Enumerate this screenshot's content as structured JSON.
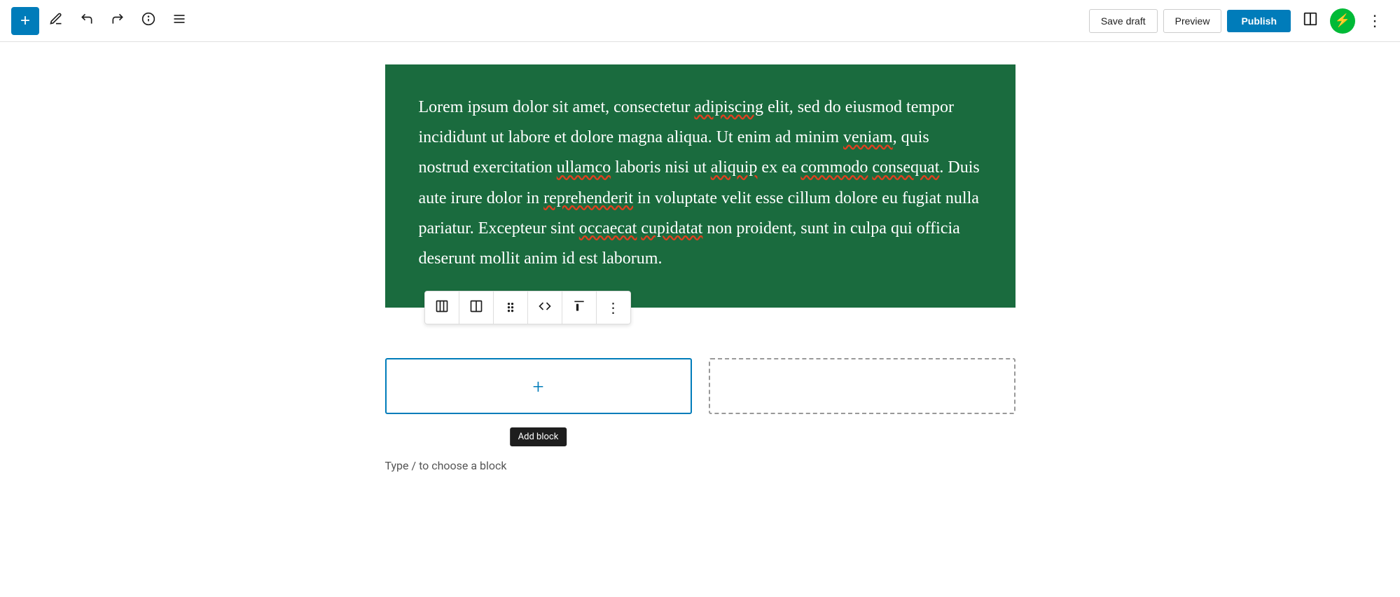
{
  "toolbar": {
    "add_button_label": "+",
    "save_draft_label": "Save draft",
    "preview_label": "Preview",
    "publish_label": "Publish",
    "tools_icon": "✏",
    "undo_icon": "↩",
    "redo_icon": "↪",
    "info_icon": "ℹ",
    "list_view_icon": "≡",
    "view_mode_icon": "▭",
    "lightning_icon": "⚡",
    "more_menu_icon": "⋮"
  },
  "green_block": {
    "text": "Lorem ipsum dolor sit amet, consectetur adipiscing elit, sed do eiusmod tempor incididunt ut labore et dolore magna aliqua. Ut enim ad minim veniam, quis nostrud exercitation ullamco laboris nisi ut aliquip ex ea commodo consequat. Duis aute irure dolor in reprehenderit in voluptate velit esse cillum dolore eu fugiat nulla pariatur. Excepteur sint occaecat cupidatat non proident, sunt in culpa qui officia deserunt mollit anim id est laborum."
  },
  "block_toolbar": {
    "btn1_icon": "columns",
    "btn2_icon": "half-columns",
    "btn3_icon": "drag",
    "btn4_icon": "code",
    "btn5_icon": "align-top",
    "btn6_icon": "more"
  },
  "two_col": {
    "add_block_label": "Add block",
    "hint_text": "Type / to choose a block"
  },
  "colors": {
    "blue": "#007cba",
    "green_bg": "#1a6b3e",
    "publish_bg": "#007cba",
    "lightning_bg": "#00ba37"
  }
}
